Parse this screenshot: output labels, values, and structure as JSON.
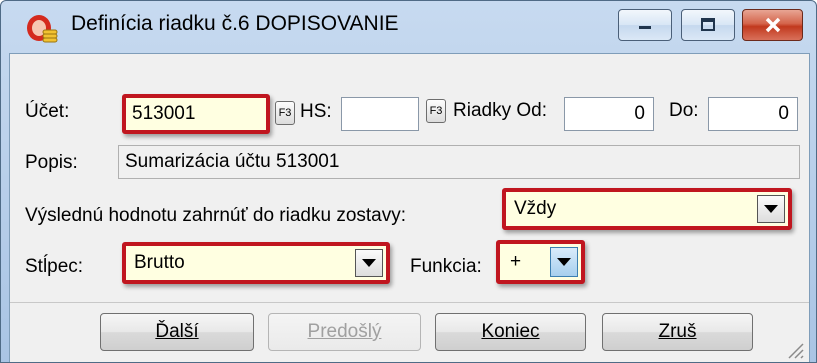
{
  "window": {
    "title": "Definícia riadku č.6 DOPISOVANIE",
    "icon": "coins-stack-icon",
    "controls": [
      "minimize",
      "maximize",
      "close"
    ]
  },
  "row1": {
    "ucet_label": "Účet:",
    "ucet_value": "513001",
    "f3_label": "F3",
    "hs_label": "HS:",
    "hs_value": "",
    "f3_label_2": "F3",
    "riadky_od_label": "Riadky Od:",
    "riadky_od_value": "0",
    "do_label": "Do:",
    "do_value": "0"
  },
  "row2": {
    "popis_label": "Popis:",
    "popis_value": "Sumarizácia účtu 513001"
  },
  "row3": {
    "label": "Výslednú hodnotu zahrnúť do riadku zostavy:",
    "value": "Vždy"
  },
  "row4": {
    "stlpec_label": "Stĺpec:",
    "stlpec_value": "Brutto",
    "funkcia_label": "Funkcia:",
    "funkcia_value": "+"
  },
  "buttons": {
    "dalsi": "Ďalší",
    "predosly": "Predošlý",
    "koniec": "Koniec",
    "zrus": "Zruš"
  },
  "colors": {
    "highlight": "#c0161f",
    "field_yellow": "#ffffe1"
  }
}
